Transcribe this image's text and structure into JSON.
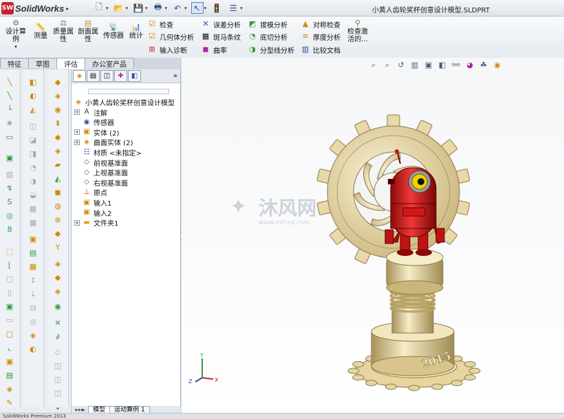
{
  "app": {
    "name": "SolidWorks",
    "badge": "SW",
    "document_title": "小黄人齿轮奖杯创意设计模型.SLDPRT"
  },
  "ribbon": {
    "big": [
      {
        "label": "设计算\n例",
        "icon": "design-study-icon"
      },
      {
        "label": "测量",
        "icon": "measure-icon"
      },
      {
        "label": "质量属\n性",
        "icon": "mass-properties-icon"
      },
      {
        "label": "剖面属\n性",
        "icon": "section-properties-icon"
      },
      {
        "label": "传感器",
        "icon": "sensor-icon"
      },
      {
        "label": "统计",
        "icon": "statistics-icon"
      }
    ],
    "small_col1": [
      {
        "label": "检查",
        "icon": "check-icon"
      },
      {
        "label": "几何体分析",
        "icon": "geometry-analysis-icon"
      },
      {
        "label": "输入诊断",
        "icon": "import-diagnostics-icon"
      }
    ],
    "small_col2": [
      {
        "label": "误差分析",
        "icon": "deviation-analysis-icon"
      },
      {
        "label": "斑马条纹",
        "icon": "zebra-stripes-icon"
      },
      {
        "label": "曲率",
        "icon": "curvature-icon"
      }
    ],
    "small_col3": [
      {
        "label": "拔模分析",
        "icon": "draft-analysis-icon"
      },
      {
        "label": "底切分析",
        "icon": "undercut-analysis-icon"
      },
      {
        "label": "分型线分析",
        "icon": "parting-line-analysis-icon"
      }
    ],
    "small_col4": [
      {
        "label": "对称检查",
        "icon": "symmetry-check-icon"
      },
      {
        "label": "厚度分析",
        "icon": "thickness-analysis-icon"
      },
      {
        "label": "比较文档",
        "icon": "compare-documents-icon"
      }
    ],
    "last_big": {
      "label": "检查激\n活的...",
      "icon": "check-active-icon"
    }
  },
  "tabs": [
    "特征",
    "草图",
    "评估",
    "办公室产品"
  ],
  "active_tab": "评估",
  "tree": [
    {
      "label": "小黄人齿轮奖杯创意设计模型",
      "icon": "part-icon",
      "level": 0,
      "exp": ""
    },
    {
      "label": "注解",
      "icon": "annotations-icon",
      "level": 1,
      "exp": "+"
    },
    {
      "label": "传感器",
      "icon": "sensors-folder-icon",
      "level": 1,
      "exp": ""
    },
    {
      "label": "实体 (2)",
      "icon": "solid-bodies-icon",
      "level": 1,
      "exp": "+"
    },
    {
      "label": "曲面实体 (2)",
      "icon": "surface-bodies-icon",
      "level": 1,
      "exp": "+"
    },
    {
      "label": "材质 <未指定>",
      "icon": "material-icon",
      "level": 1,
      "exp": ""
    },
    {
      "label": "前视基准面",
      "icon": "plane-icon",
      "level": 1,
      "exp": ""
    },
    {
      "label": "上视基准面",
      "icon": "plane-icon",
      "level": 1,
      "exp": ""
    },
    {
      "label": "右视基准面",
      "icon": "plane-icon",
      "level": 1,
      "exp": ""
    },
    {
      "label": "原点",
      "icon": "origin-icon",
      "level": 1,
      "exp": ""
    },
    {
      "label": "输入1",
      "icon": "imported-feature-icon",
      "level": 1,
      "exp": ""
    },
    {
      "label": "输入2",
      "icon": "imported-feature-icon",
      "level": 1,
      "exp": ""
    },
    {
      "label": "文件夹1",
      "icon": "folder-icon",
      "level": 1,
      "exp": "+"
    }
  ],
  "bottom_tabs": [
    "模型",
    "运动算例 1"
  ],
  "model": {
    "year_text": "2015",
    "watermark": "沐风网",
    "watermark_url": "www.mfcad.com"
  },
  "status": "SolidWorks Premium 2013"
}
